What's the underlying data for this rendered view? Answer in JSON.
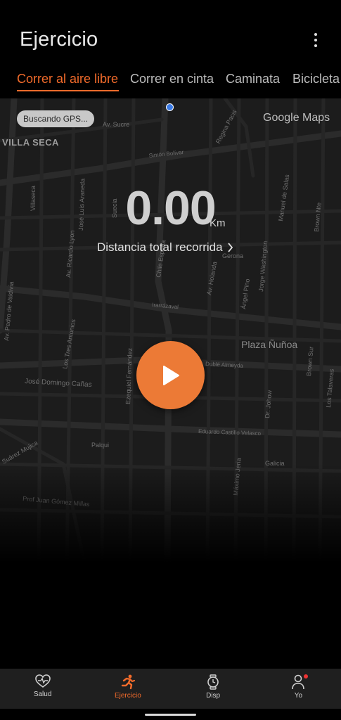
{
  "header": {
    "title": "Ejercicio",
    "more_icon": "more-vertical-icon"
  },
  "tabs": [
    {
      "label": "Correr al aire libre",
      "active": true
    },
    {
      "label": "Correr en cinta",
      "active": false
    },
    {
      "label": "Caminata",
      "active": false
    },
    {
      "label": "Bicicleta",
      "active": false
    }
  ],
  "map": {
    "gps_status": "Buscando GPS...",
    "provider": "Google Maps",
    "district": "VILLA SECA",
    "place": "Plaza Ñuñoa",
    "streets": [
      "Av. Sucre",
      "Simón Bolívar",
      "Regina Pacis",
      "Villaseca",
      "José Luis Araneda",
      "Av. Ricardo Lyon",
      "Suecia",
      "Chile España",
      "Manuel de Salas",
      "Brown Nte",
      "Jorge Washington",
      "Gerona",
      "Av. Pedro de Valdivia",
      "Los Tres Antonios",
      "Ezequiel Fernández",
      "Av. Holanda",
      "Ángel Pino",
      "Irarrázaval",
      "Dublé Almeyda",
      "José Domingo Cañas",
      "Dr. Johow",
      "Brown Sur",
      "Los Talaveras",
      "Eduardo Castillo Velasco",
      "Palqui",
      "Suárez Mujica",
      "Juan Gómez Millas",
      "Galicia",
      "Máximo Jeria"
    ],
    "accent_colors": {
      "orange": "#f26b2b",
      "gps_blue": "#3b7be6"
    }
  },
  "distance": {
    "value": "0.00",
    "unit": "Km",
    "label": "Distancia total recorrida"
  },
  "start_button": {
    "icon": "play-icon",
    "color": "#ec7a36"
  },
  "bottom_nav": [
    {
      "label": "Salud",
      "icon": "heart-pulse-icon",
      "active": false
    },
    {
      "label": "Ejercicio",
      "icon": "runner-icon",
      "active": true
    },
    {
      "label": "Disp",
      "icon": "watch-icon",
      "active": false
    },
    {
      "label": "Yo",
      "icon": "person-icon",
      "active": false,
      "badge": true
    }
  ]
}
